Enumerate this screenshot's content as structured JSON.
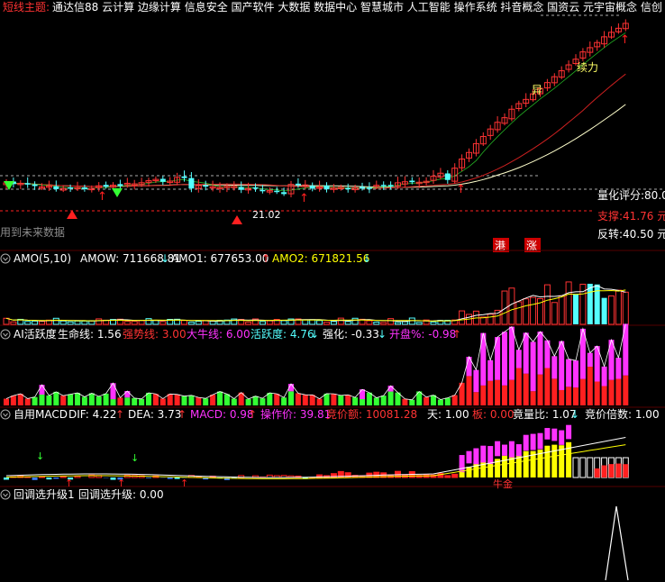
{
  "colors": {
    "bg": "#000000",
    "up": "#ff3333",
    "down": "#54ffff",
    "white": "#ffffff",
    "yellow": "#ffff00",
    "magenta": "#ff33ff",
    "green": "#33ff33",
    "olive": "#a8a862",
    "red": "#ff2020",
    "blue": "#3b7bff",
    "gray": "#8c8c8c",
    "orange": "#ff6060",
    "pink": "#ff88ff",
    "darkred": "#cc2020",
    "cream": "#ffffcc",
    "dashed": "#aaaaaa"
  },
  "topbar": {
    "prefix": "短线主题:",
    "text": "通达信88 云计算 边缘计算 信息安全 国产软件 大数据 数据中心 智慧城市 人工智能 操作系统 抖音概念 国资云 元宇宙概念 信创 东"
  },
  "main": {
    "label_rating": "量化评分:80.0",
    "label_support": "支撑:41.76 元",
    "label_reversal": "反转:40.50 元",
    "label_future": "用到未来数据",
    "low_price": "21.02",
    "tag_yi": "异",
    "tag_xuli": "续力",
    "badge_gang": "港",
    "badge_zhang": "涨"
  },
  "panels": {
    "amo": {
      "name": "AMO(5,10)",
      "amow": "AMOW: 711668.81",
      "amo1": "AMO1: 677653.00",
      "amo2": "AMO2: 671821.56"
    },
    "ai": {
      "name": "AI活跃度",
      "life": "生命线: 1.56",
      "strong": "强势线: 3.00",
      "bull": "大牛线: 6.00",
      "active": "活跃度: 4.76",
      "qiang": "强化: -0.33",
      "open": "开盘%: -0.98"
    },
    "macd": {
      "name": "自用MACD",
      "dif": "DIF: 4.22",
      "dea": "DEA: 3.73",
      "macd": "MACD: 0.98",
      "op": "操作价: 39.81",
      "bid": "竞价额: 10081.28",
      "tian": "天: 1.00",
      "ban": "板: 0.00",
      "ratio": "竟量比: 1.07",
      "times": "竞价倍数: 1.00",
      "tag": "牛金"
    },
    "huitiao": {
      "name": "回调选升级1",
      "value": "回调选升级: 0.00"
    }
  },
  "icons": {
    "menu": "circle-dropdown-icon",
    "up": "up-arrow-icon",
    "down": "down-arrow-icon"
  }
}
